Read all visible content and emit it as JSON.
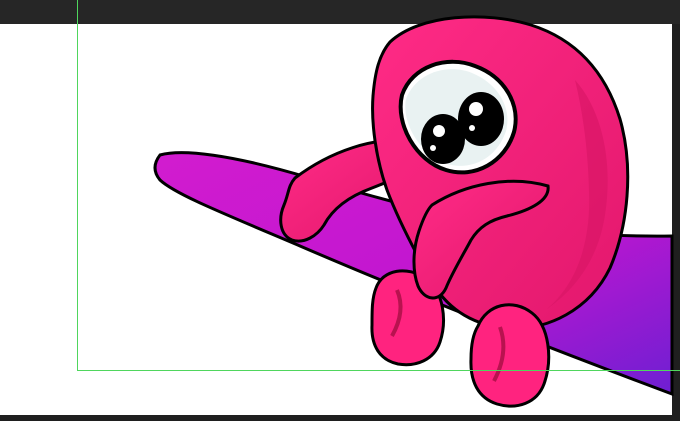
{
  "colors": {
    "workspace": "#282828",
    "canvas": "#ffffff",
    "guide": "#4fd65d",
    "character_pink": "#ff1f7a",
    "character_shadow": "#d01762",
    "branch_magenta": "#cc18c8",
    "branch_purple": "#7a1fd8",
    "outline": "#000000"
  },
  "icons": {
    "artwork": "pink-character-on-branch-illustration",
    "guides": "guide-lines"
  }
}
